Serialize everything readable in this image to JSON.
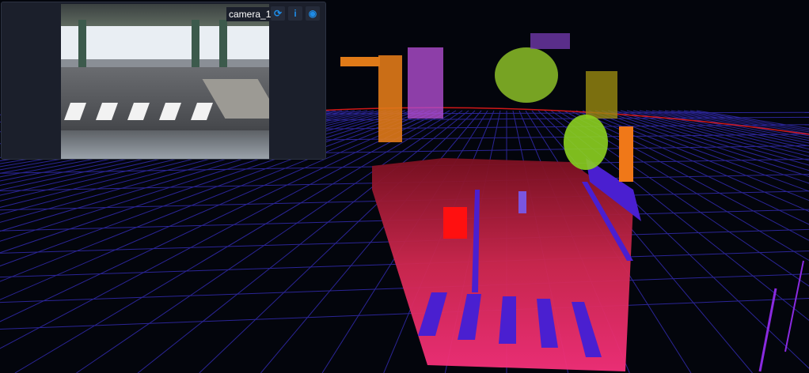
{
  "camera_panel": {
    "label": "camera_1",
    "buttons": [
      {
        "name": "refresh-icon",
        "glyph": "⟳"
      },
      {
        "name": "info-icon",
        "glyph": "i"
      },
      {
        "name": "eye-icon",
        "glyph": "◉"
      }
    ]
  },
  "colors": {
    "background": "#03050c",
    "grid": "#2b2596",
    "horizon": "#d01818",
    "ground_near": "#f0306a",
    "ground_far": "#b01838",
    "lane_marks": "#4a1fd0",
    "accent": "#1e8be6"
  }
}
